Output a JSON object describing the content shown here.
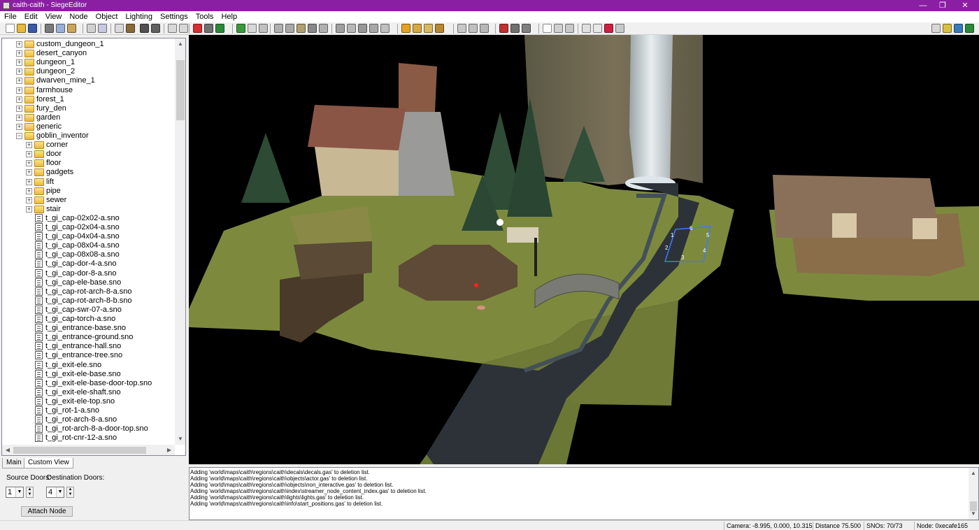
{
  "window": {
    "title": "caith-caith - SiegeEditor",
    "controls": {
      "minimize": "—",
      "restore": "❐",
      "close": "✕"
    }
  },
  "menubar": {
    "items": [
      "File",
      "Edit",
      "View",
      "Node",
      "Object",
      "Lighting",
      "Settings",
      "Tools",
      "Help"
    ]
  },
  "toolbar": {
    "buttons": [
      {
        "icon": "new-file-icon",
        "color": "#ffffff"
      },
      {
        "icon": "open-folder-icon",
        "color": "#e8b93a"
      },
      {
        "icon": "save-icon",
        "color": "#3a5aa8"
      },
      {
        "icon": "cut-icon",
        "color": "#7a7a7a"
      },
      {
        "icon": "copy-icon",
        "color": "#9ab0d8"
      },
      {
        "icon": "paste-icon",
        "color": "#c9a45a"
      },
      {
        "icon": "select-node-icon",
        "color": "#d0d0d0"
      },
      {
        "icon": "select-object-icon",
        "color": "#c8c8e0"
      },
      {
        "icon": "grid-icon",
        "color": "#dadada"
      },
      {
        "icon": "hammer-icon",
        "color": "#8a6a3a"
      },
      {
        "icon": "view-a-icon",
        "color": "#505050"
      },
      {
        "icon": "view-b-icon",
        "color": "#606060"
      },
      {
        "icon": "rotate-left-icon",
        "color": "#d8d8d8"
      },
      {
        "icon": "rotate-right-icon",
        "color": "#d8d8d8"
      },
      {
        "icon": "stop-icon",
        "color": "#d83030"
      },
      {
        "icon": "bucket-icon",
        "color": "#707070"
      },
      {
        "icon": "green-flag-icon",
        "color": "#2a8a3a"
      },
      {
        "icon": "wand-icon",
        "color": "#3a9a3a"
      },
      {
        "icon": "down-arrow-icon",
        "color": "#d8d8d8"
      },
      {
        "icon": "move-icon",
        "color": "#c0c0c0"
      },
      {
        "icon": "link-icon",
        "color": "#b0b0b0"
      },
      {
        "icon": "sparkle-icon",
        "color": "#a8a8a8"
      },
      {
        "icon": "person-icon",
        "color": "#b0a070"
      },
      {
        "icon": "pen-icon",
        "color": "#888888"
      },
      {
        "icon": "pivot-icon",
        "color": "#b0b0b0"
      },
      {
        "icon": "crosshair-icon",
        "color": "#a0a0a0"
      },
      {
        "icon": "rotate-icon",
        "color": "#b8b8b8"
      },
      {
        "icon": "lock-a-icon",
        "color": "#989898"
      },
      {
        "icon": "lock-b-icon",
        "color": "#a8a8a8"
      },
      {
        "icon": "lock-c-icon",
        "color": "#c0c0c0"
      },
      {
        "icon": "sun-icon",
        "color": "#e8a020"
      },
      {
        "icon": "light-grid-icon",
        "color": "#d8a840"
      },
      {
        "icon": "light-edit-icon",
        "color": "#d8b860"
      },
      {
        "icon": "light-box-icon",
        "color": "#b88830"
      },
      {
        "icon": "pointer-a-icon",
        "color": "#c8c8c8"
      },
      {
        "icon": "pointer-b-icon",
        "color": "#c0c0c0"
      },
      {
        "icon": "pointer-c-icon",
        "color": "#b8b8b8"
      },
      {
        "icon": "red-flag-icon",
        "color": "#c03030"
      },
      {
        "icon": "camera-icon",
        "color": "#707070"
      },
      {
        "icon": "film-icon",
        "color": "#808080"
      },
      {
        "icon": "circle-icon",
        "color": "#ffffff"
      },
      {
        "icon": "arrow-a-icon",
        "color": "#d0d0d0"
      },
      {
        "icon": "arrow-b-icon",
        "color": "#c8c8c8"
      },
      {
        "icon": "doc-a-icon",
        "color": "#e0e0e0"
      },
      {
        "icon": "doc-b-icon",
        "color": "#e8e8e8"
      },
      {
        "icon": "color-blocks-icon",
        "color": "#d02040"
      },
      {
        "icon": "info-icon",
        "color": "#c8c8c8"
      },
      {
        "icon": "nav-back-icon",
        "color": "#d8d8d8"
      },
      {
        "icon": "nav-home-icon",
        "color": "#d8c040"
      },
      {
        "icon": "nav-flag-icon",
        "color": "#3a7ab8"
      },
      {
        "icon": "nav-save-icon",
        "color": "#2a8a3a"
      }
    ]
  },
  "tree": {
    "top_folders": [
      "custom_dungeon_1",
      "desert_canyon",
      "dungeon_1",
      "dungeon_2",
      "dwarven_mine_1",
      "farmhouse",
      "forest_1",
      "fury_den",
      "garden",
      "generic",
      "goblin_inventor"
    ],
    "sub_folders": [
      "corner",
      "door",
      "floor",
      "gadgets",
      "lift",
      "pipe",
      "sewer",
      "stair"
    ],
    "files": [
      "t_gi_cap-02x02-a.sno",
      "t_gi_cap-02x04-a.sno",
      "t_gi_cap-04x04-a.sno",
      "t_gi_cap-08x04-a.sno",
      "t_gi_cap-08x08-a.sno",
      "t_gi_cap-dor-4-a.sno",
      "t_gi_cap-dor-8-a.sno",
      "t_gi_cap-ele-base.sno",
      "t_gi_cap-rot-arch-8-a.sno",
      "t_gi_cap-rot-arch-8-b.sno",
      "t_gi_cap-swr-07-a.sno",
      "t_gi_cap-torch-a.sno",
      "t_gi_entrance-base.sno",
      "t_gi_entrance-ground.sno",
      "t_gi_entrance-hall.sno",
      "t_gi_entrance-tree.sno",
      "t_gi_exit-ele.sno",
      "t_gi_exit-ele-base.sno",
      "t_gi_exit-ele-base-door-top.sno",
      "t_gi_exit-ele-shaft.sno",
      "t_gi_exit-ele-top.sno",
      "t_gi_rot-1-a.sno",
      "t_gi_rot-arch-8-a.sno",
      "t_gi_rot-arch-8-a-door-top.sno",
      "t_gi_rot-cnr-12-a.sno"
    ]
  },
  "tabs": [
    "Main",
    "Custom View"
  ],
  "attach": {
    "source_label": "Source Doors:",
    "dest_label": "Destination Doors:",
    "source_value": "1",
    "dest_value": "4",
    "button": "Attach Node"
  },
  "viewport": {
    "door_numbers": [
      "6",
      "1",
      "2",
      "3",
      "4",
      "5"
    ],
    "colors": {
      "background": "#000000",
      "grass": "#7a8a3c",
      "water": "#2c3238",
      "cliff": "#6e6650",
      "selection": "#3a7aff"
    }
  },
  "log": {
    "lines": [
      "Adding 'world\\maps\\caith\\regions\\caith\\decals\\decals.gas' to deletion list.",
      "Adding 'world\\maps\\caith\\regions\\caith\\objects\\actor.gas' to deletion list.",
      "Adding 'world\\maps\\caith\\regions\\caith\\objects\\non_interactive.gas' to deletion list.",
      "Adding 'world\\maps\\caith\\regions\\caith\\index\\streamer_node_content_index.gas' to deletion list.",
      "Adding 'world\\maps\\caith\\regions\\caith\\lights\\lights.gas' to deletion list.",
      "Adding 'world\\maps\\caith\\regions\\caith\\info\\start_positions.gas' to deletion list."
    ]
  },
  "status": {
    "camera": "Camera: -8.995, 0.000, 10.315",
    "distance": "Distance 75.500",
    "snos": "SNOs: 70/73",
    "node": "Node: 0xecafe165"
  }
}
